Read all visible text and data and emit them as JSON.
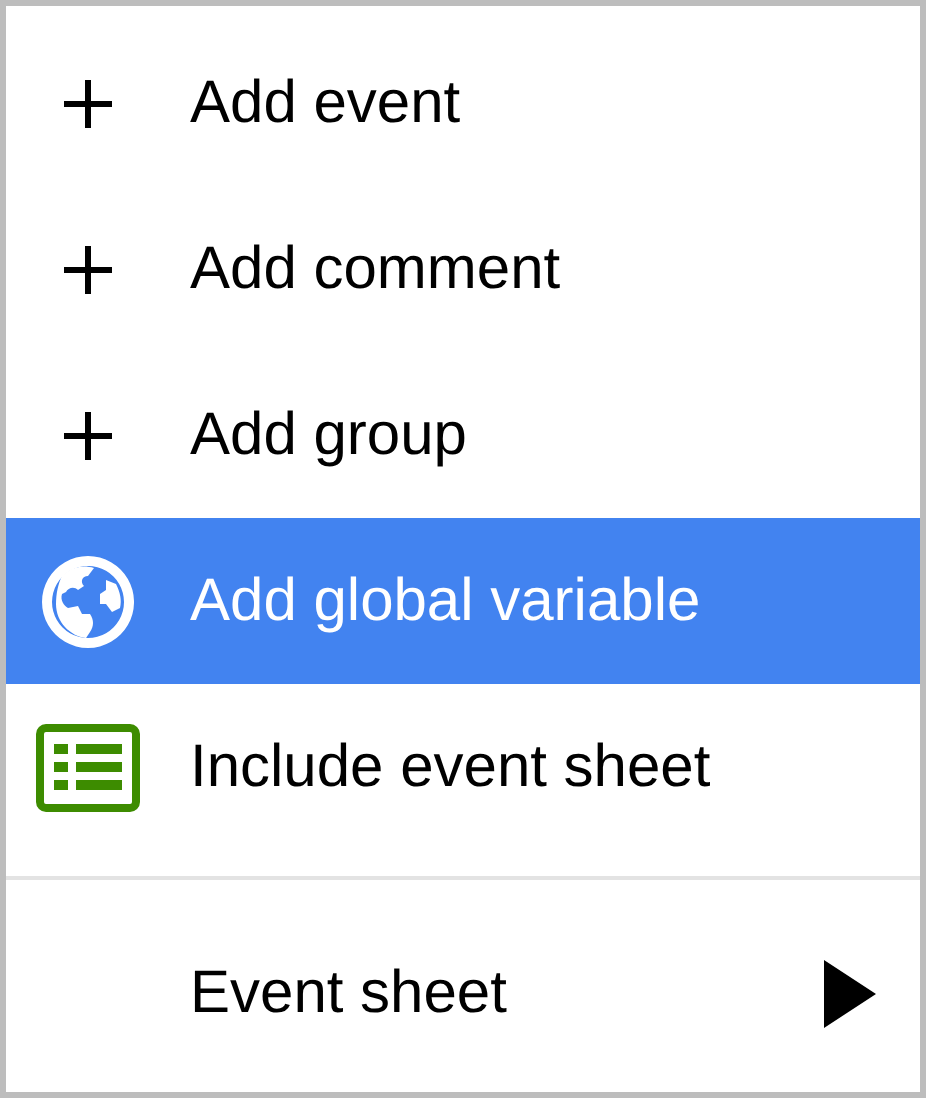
{
  "menu": {
    "items": [
      {
        "kind": "plus",
        "label": "Add event",
        "selected": false
      },
      {
        "kind": "plus",
        "label": "Add comment",
        "selected": false
      },
      {
        "kind": "plus",
        "label": "Add group",
        "selected": false
      },
      {
        "kind": "globe",
        "label": "Add global variable",
        "selected": true
      },
      {
        "kind": "sheet",
        "label": "Include event sheet",
        "selected": false
      }
    ],
    "submenu_items": [
      {
        "label": "Event sheet",
        "selected": false
      }
    ]
  }
}
